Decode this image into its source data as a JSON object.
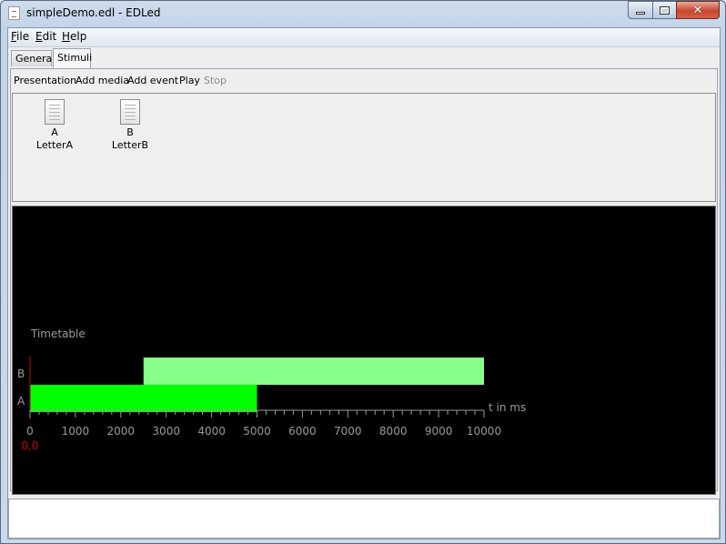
{
  "window": {
    "title": "simpleDemo.edl - EDLed",
    "controls": {
      "minimize": "minimize",
      "maximize": "maximize",
      "close": "close"
    }
  },
  "menu": {
    "items": [
      {
        "label": "File",
        "mnemonic": "F",
        "rest": "ile"
      },
      {
        "label": "Edit",
        "mnemonic": "E",
        "rest": "dit"
      },
      {
        "label": "Help",
        "mnemonic": "H",
        "rest": "elp"
      }
    ]
  },
  "tabs": [
    {
      "label": "General",
      "active": false
    },
    {
      "label": "Stimuli",
      "active": true
    }
  ],
  "toolbar": {
    "presentation": "Presentation",
    "add_media": "Add media",
    "add_event": "Add event",
    "play": "Play",
    "stop": "Stop"
  },
  "stimuli": [
    {
      "id": "A",
      "name": "LetterA",
      "icon": "document-icon"
    },
    {
      "id": "B",
      "name": "LetterB",
      "icon": "document-icon"
    }
  ],
  "chart_data": {
    "type": "gantt",
    "title": "Timetable",
    "xlabel": "t in ms",
    "xlim": [
      0,
      10000
    ],
    "xticks": [
      0,
      1000,
      2000,
      3000,
      4000,
      5000,
      6000,
      7000,
      8000,
      9000,
      10000
    ],
    "minor_tick_step": 200,
    "origin_label": "0,0",
    "rows": [
      {
        "label": "A",
        "start": 0,
        "end": 5000,
        "color": "#00ff00"
      },
      {
        "label": "B",
        "start": 2500,
        "end": 10000,
        "color": "#88ff88"
      }
    ],
    "colors": {
      "background": "#000000",
      "axis": "#9a9a9a",
      "origin": "#cc0000"
    }
  }
}
